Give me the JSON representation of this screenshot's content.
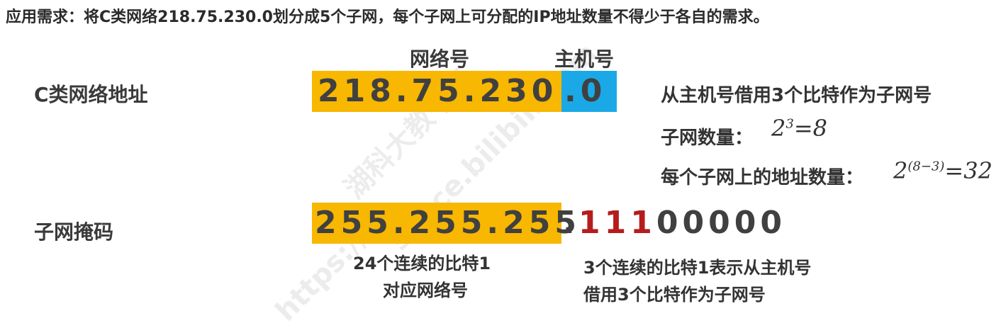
{
  "title": "应用需求：将C类网络218.75.230.0划分成5个子网，每个子网上可分配的IP地址数量不得少于各自的需求。",
  "headers": {
    "network": "网络号",
    "host": "主机号"
  },
  "address": {
    "label": "C类网络地址",
    "network_part": "218.75.230",
    "host_part": ".0"
  },
  "mask": {
    "label": "子网掩码",
    "network_part": "255.255.255",
    "dot": ".",
    "borrowed_bits": "111",
    "host_bits": "00000"
  },
  "notes": {
    "borrow": "从主机号借用3个比特作为子网号",
    "subnet_count_label": "子网数量：",
    "subnet_count_base": "2",
    "subnet_count_exp": "3",
    "subnet_count_result": "=8",
    "addr_count_label": "每个子网上的地址数量：",
    "addr_count_base": "2",
    "addr_count_exp": "(8−3)",
    "addr_count_result": "=32"
  },
  "captions": {
    "left_line1": "24个连续的比特1",
    "left_line2": "对应网络号",
    "right_line1": "3个连续的比特1表示从主机号",
    "right_line2": "借用3个比特作为子网号"
  },
  "colors": {
    "network_bg": "#f8b700",
    "host_bg": "#1aa9e6",
    "borrowed_bits": "#b61c1c"
  }
}
